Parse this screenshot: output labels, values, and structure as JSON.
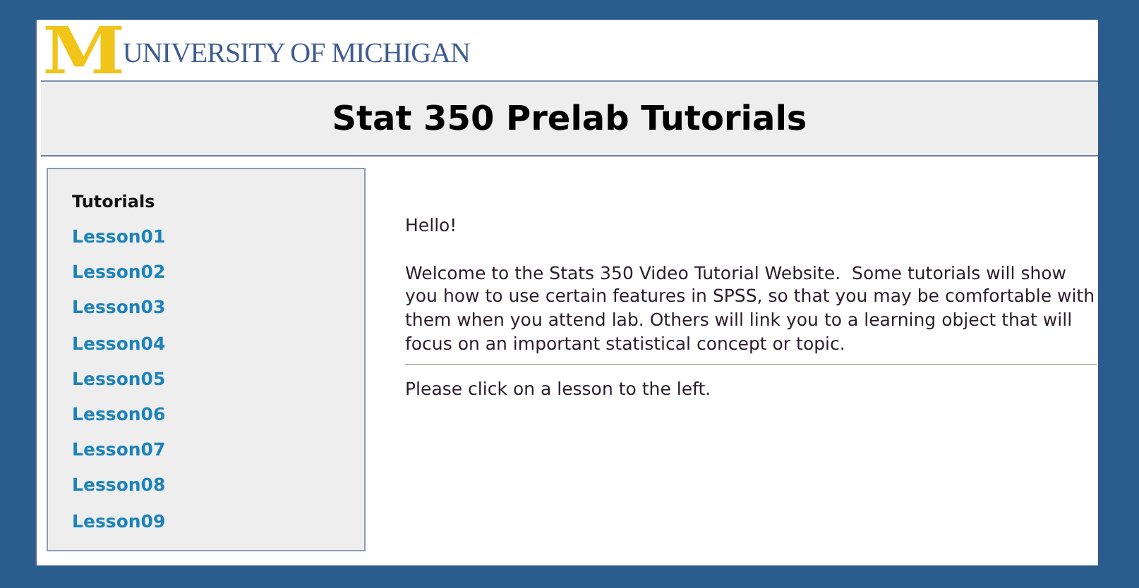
{
  "logo": {
    "mark": "M",
    "text": "UNIVERSITY OF MICHIGAN"
  },
  "header": {
    "title": "Stat 350 Prelab Tutorials"
  },
  "sidebar": {
    "heading": "Tutorials",
    "items": [
      "Lesson01",
      "Lesson02",
      "Lesson03",
      "Lesson04",
      "Lesson05",
      "Lesson06",
      "Lesson07",
      "Lesson08",
      "Lesson09"
    ]
  },
  "content": {
    "greeting": "Hello!",
    "paragraph": "Welcome to the Stats 350 Video Tutorial Website.  Some tutorials will show you how to use certain features in SPSS, so that you may be comfortable with them when you attend lab. Others will link you to a learning object that will focus on an important statistical concept or topic.",
    "instruction": "Please click on a lesson to the left."
  }
}
